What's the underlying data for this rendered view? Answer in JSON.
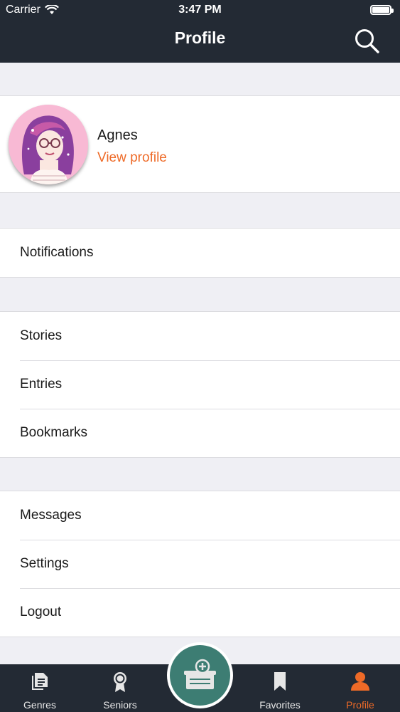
{
  "status_bar": {
    "carrier": "Carrier",
    "time": "3:47 PM"
  },
  "header": {
    "title": "Profile"
  },
  "profile": {
    "name": "Agnes",
    "view_profile": "View profile"
  },
  "groups": [
    {
      "items": [
        "Notifications"
      ]
    },
    {
      "items": [
        "Stories",
        "Entries",
        "Bookmarks"
      ]
    },
    {
      "items": [
        "Messages",
        "Settings",
        "Logout"
      ]
    }
  ],
  "tabs": [
    {
      "label": "Genres",
      "icon": "document-icon"
    },
    {
      "label": "Seniors",
      "icon": "award-icon"
    },
    {
      "label": "Favorites",
      "icon": "bookmark-icon"
    },
    {
      "label": "Profile",
      "icon": "person-icon",
      "active": true
    }
  ],
  "colors": {
    "accent": "#ee6a27",
    "header": "#232a34",
    "compose": "#3d7d73",
    "background": "#efeff4"
  }
}
